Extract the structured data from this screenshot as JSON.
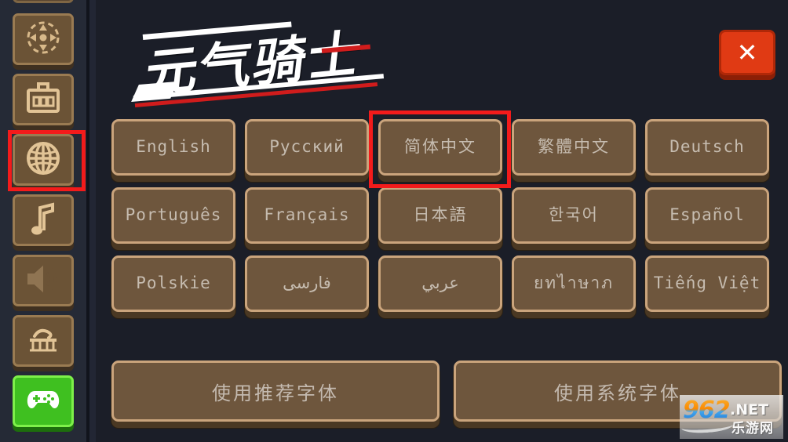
{
  "window": {
    "title": "元气骑士",
    "background_color": "#1b1e28"
  },
  "header": {
    "logo_text": "元气骑士",
    "close_label": "✕"
  },
  "sidebar": {
    "background_color": "#252a36",
    "items": [
      {
        "name": "partial-top-button",
        "icon": "blank-icon",
        "label": ""
      },
      {
        "name": "controls",
        "icon": "dpad-icon",
        "label": ""
      },
      {
        "name": "inventory",
        "icon": "toolbox-icon",
        "label": ""
      },
      {
        "name": "language",
        "icon": "globe-icon",
        "label": ""
      },
      {
        "name": "music",
        "icon": "music-note-icon",
        "label": ""
      },
      {
        "name": "sound",
        "icon": "speaker-icon",
        "label": ""
      },
      {
        "name": "shop",
        "icon": "shop-cart-icon",
        "label": ""
      },
      {
        "name": "play",
        "icon": "gamepad-icon",
        "label": ""
      }
    ]
  },
  "main": {
    "languages": [
      [
        {
          "label": "English",
          "script": "latin",
          "selected": false
        },
        {
          "label": "Русский",
          "script": "latin",
          "selected": false
        },
        {
          "label": "简体中文",
          "script": "cjk",
          "selected": true
        },
        {
          "label": "繁體中文",
          "script": "cjk",
          "selected": false
        },
        {
          "label": "Deutsch",
          "script": "latin",
          "selected": false
        }
      ],
      [
        {
          "label": "Português",
          "script": "latin",
          "selected": false
        },
        {
          "label": "Français",
          "script": "latin",
          "selected": false
        },
        {
          "label": "日本語",
          "script": "cjk",
          "selected": false
        },
        {
          "label": "한국어",
          "script": "cjk",
          "selected": false
        },
        {
          "label": "Español",
          "script": "latin",
          "selected": false
        }
      ],
      [
        {
          "label": "Polskie",
          "script": "latin",
          "selected": false
        },
        {
          "label": "فارسى",
          "script": "arabic",
          "selected": false
        },
        {
          "label": "عربي",
          "script": "arabic",
          "selected": false
        },
        {
          "label": "ยทไาษาภ",
          "script": "thai",
          "selected": false
        },
        {
          "label": "Tiếng Việt",
          "script": "latin",
          "selected": false
        }
      ]
    ],
    "font_buttons": [
      {
        "name": "use-recommended-font",
        "label": "使用推荐字体"
      },
      {
        "name": "use-system-font",
        "label": "使用系统字体"
      }
    ]
  },
  "annotations": {
    "color": "#f31b1b",
    "boxes": [
      {
        "name": "sidebar-language-highlight",
        "target": "globe-icon-button"
      },
      {
        "name": "simplified-chinese-highlight",
        "target": "简体中文"
      }
    ]
  },
  "watermark": {
    "number": "962",
    "tld": ".NET",
    "chinese": "乐游网"
  }
}
